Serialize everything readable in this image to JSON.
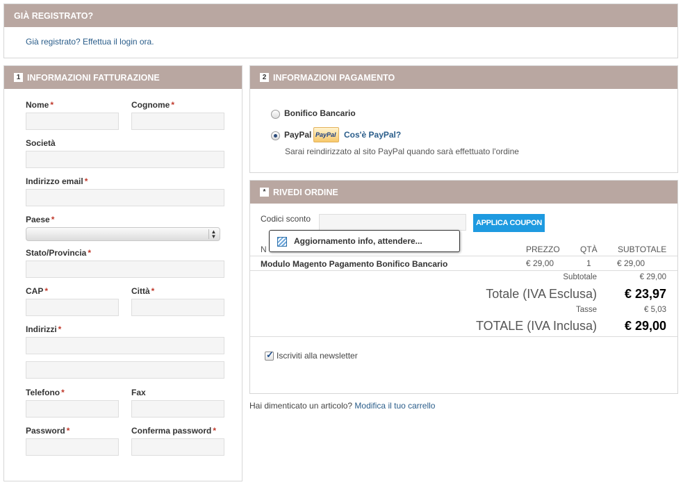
{
  "already_registered": {
    "title": "GIÀ REGISTRATO?",
    "text": "Già registrato? Effettua il login ora."
  },
  "billing": {
    "number": "1",
    "title": "INFORMAZIONI FATTURAZIONE",
    "required_mark": "*",
    "fields": {
      "nome": "Nome",
      "cognome": "Cognome",
      "societa": "Società",
      "email": "Indirizzo email",
      "paese": "Paese",
      "stato": "Stato/Provincia",
      "cap": "CAP",
      "citta": "Città",
      "indirizzi": "Indirizzi",
      "telefono": "Telefono",
      "fax": "Fax",
      "password": "Password",
      "conferma": "Conferma password"
    },
    "paese_value": ""
  },
  "payment": {
    "number": "2",
    "title": "INFORMAZIONI PAGAMENTO",
    "options": [
      {
        "label": "Bonifico Bancario",
        "selected": false
      },
      {
        "label": "PayPal",
        "selected": true
      }
    ],
    "paypal_logo": "PayPal",
    "paypal_link": "Cos'è PayPal?",
    "paypal_note": "Sarai reindirizzato al sito PayPal quando sarà effettuato l'ordine"
  },
  "review": {
    "number": "*",
    "title": "RIVEDI ORDINE",
    "coupon_label": "Codici sconto",
    "coupon_value": "",
    "coupon_button": "APPLICA COUPON",
    "loading_text": "Aggiornamento info, attendere...",
    "columns": {
      "name": "N",
      "price": "PREZZO",
      "qty": "QTÀ",
      "subtotal": "SUBTOTALE"
    },
    "items": [
      {
        "name": "Modulo Magento Pagamento Bonifico Bancario",
        "price": "€ 29,00",
        "qty": "1",
        "subtotal": "€ 29,00"
      }
    ],
    "totals": {
      "subtotal_label": "Subtotale",
      "subtotal_value": "€ 29,00",
      "excl_label": "Totale (IVA Esclusa)",
      "excl_value": "€ 23,97",
      "tax_label": "Tasse",
      "tax_value": "€ 5,03",
      "incl_label": "TOTALE (IVA Inclusa)",
      "incl_value": "€ 29,00"
    },
    "newsletter_label": "Iscriviti alla newsletter",
    "newsletter_checked": true
  },
  "footer": {
    "forgot_text": "Hai dimenticato un articolo?",
    "edit_cart_link": "Modifica il tuo carrello"
  },
  "colors": {
    "header_bg": "#b9a7a1",
    "coupon_button": "#1e9ae0",
    "link": "#2a5d8a",
    "required": "#c0392b"
  }
}
